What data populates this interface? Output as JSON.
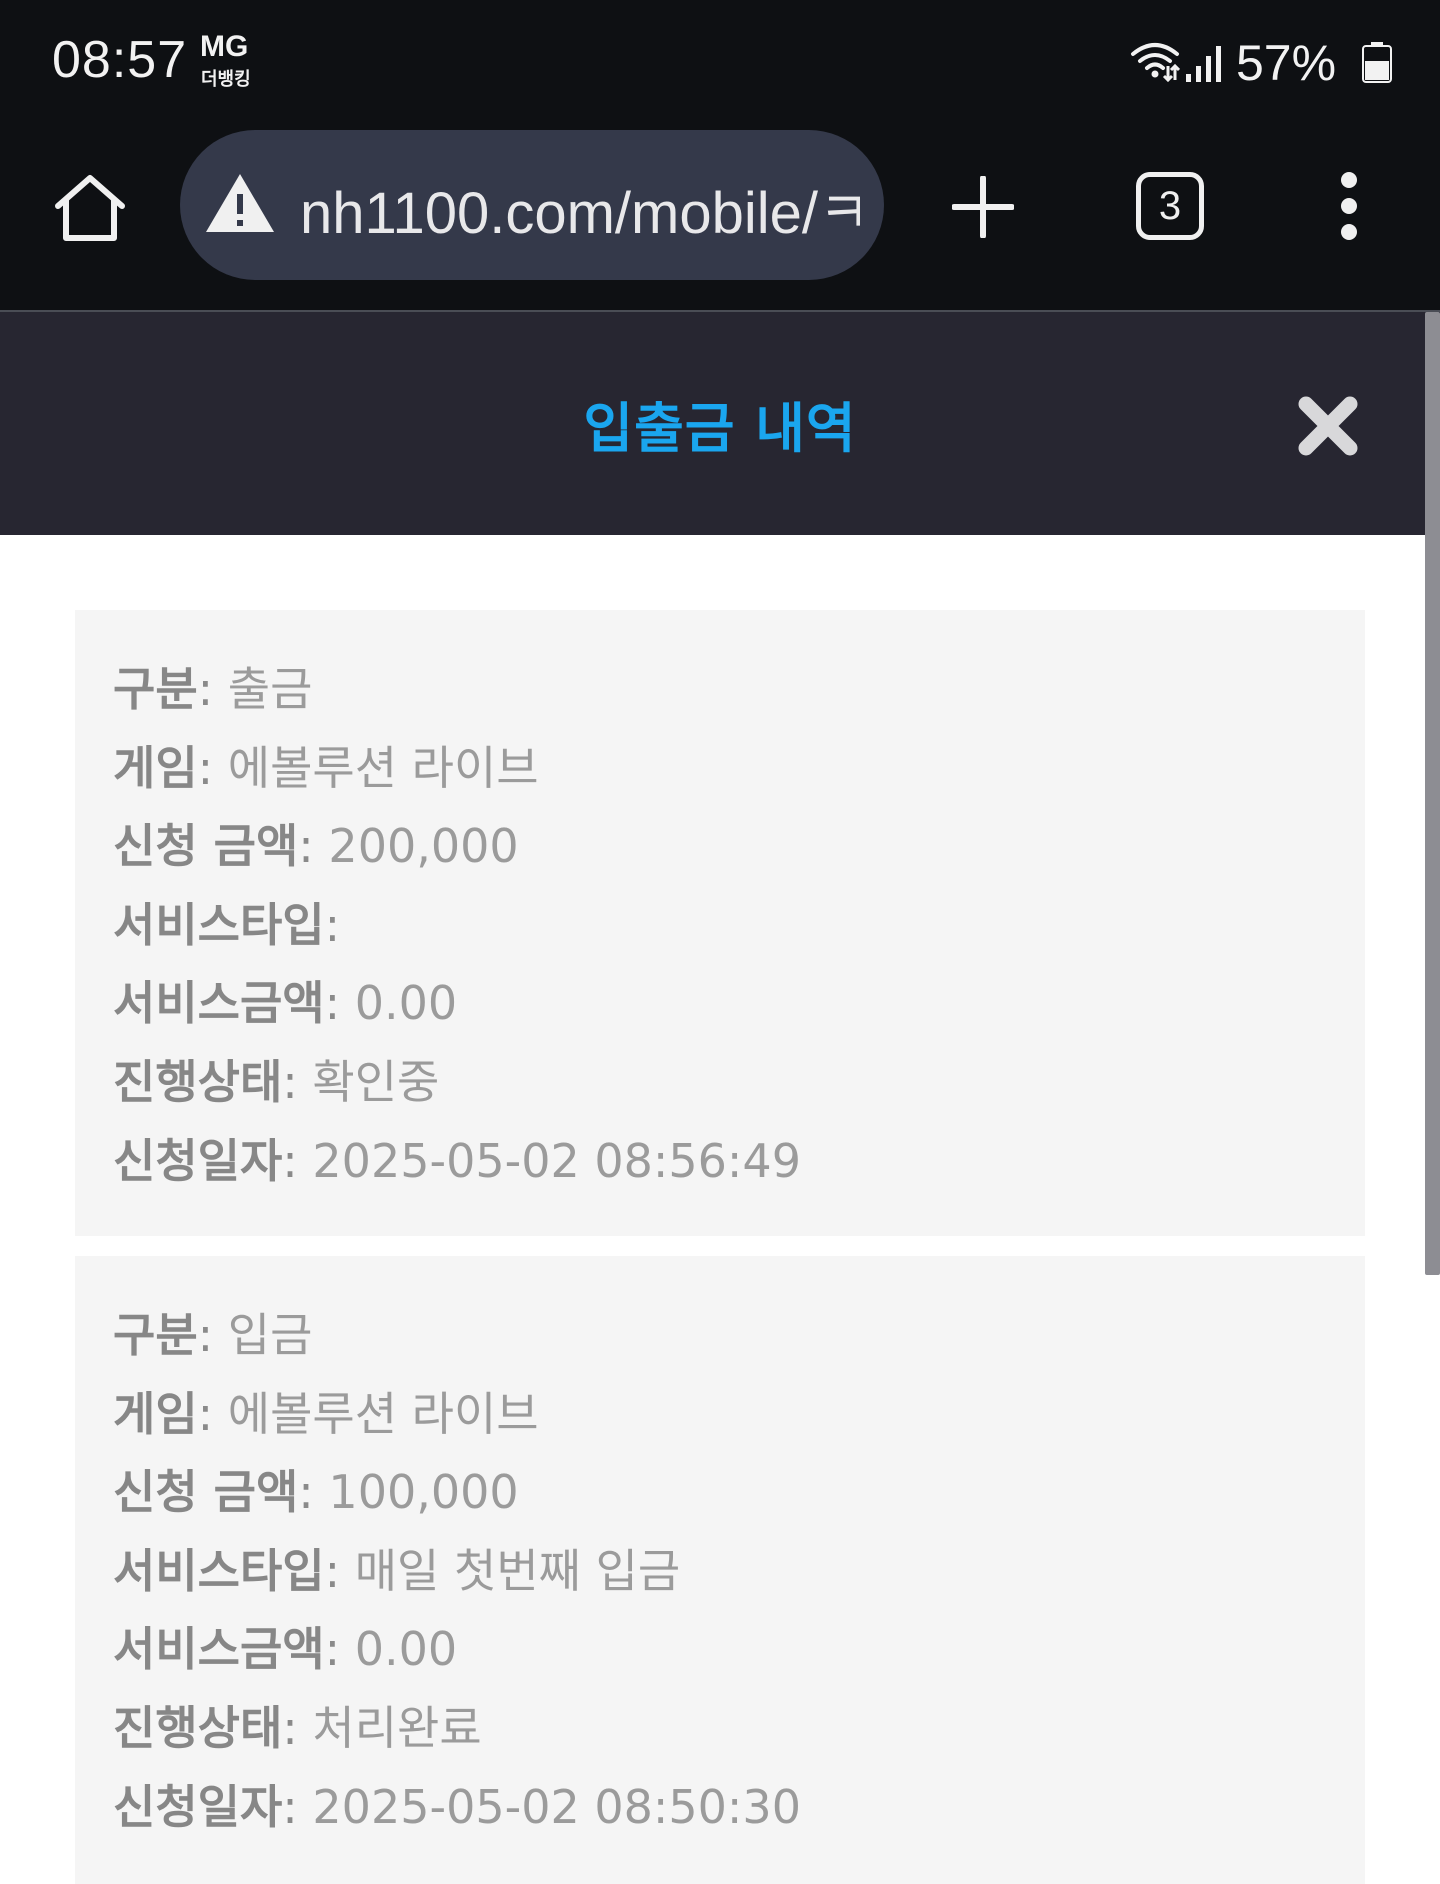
{
  "status_bar": {
    "time": "08:57",
    "carrier": "MG",
    "carrier_sub": "더뱅킹",
    "battery": "57%",
    "icons": [
      "wifi-icon",
      "signal-icon",
      "battery-icon"
    ]
  },
  "browser": {
    "url": "nh1100.com/mobile/ㅋ",
    "tab_count": "3",
    "icons": [
      "home-icon",
      "warning-icon",
      "plus-icon",
      "more-vert-icon"
    ]
  },
  "header": {
    "title": "입출금 내역",
    "title_color": "#1aa6ef",
    "close_icon": "close-x-icon"
  },
  "separator": ":",
  "labels": {
    "type": "구분",
    "game": "게임",
    "amount": "신청 금액",
    "service_type": "서비스타입",
    "service_amount": "서비스금액",
    "status": "진행상태",
    "date": "신청일자"
  },
  "records": [
    {
      "type": "출금",
      "game": "에볼루션 라이브",
      "amount": "200,000",
      "service_type": "",
      "service_amount": "0.00",
      "status": "확인중",
      "date": "2025-05-02 08:56:49"
    },
    {
      "type": "입금",
      "game": "에볼루션 라이브",
      "amount": "100,000",
      "service_type": "매일 첫번째 입금",
      "service_amount": "0.00",
      "status": "처리완료",
      "date": "2025-05-02 08:50:30"
    }
  ]
}
